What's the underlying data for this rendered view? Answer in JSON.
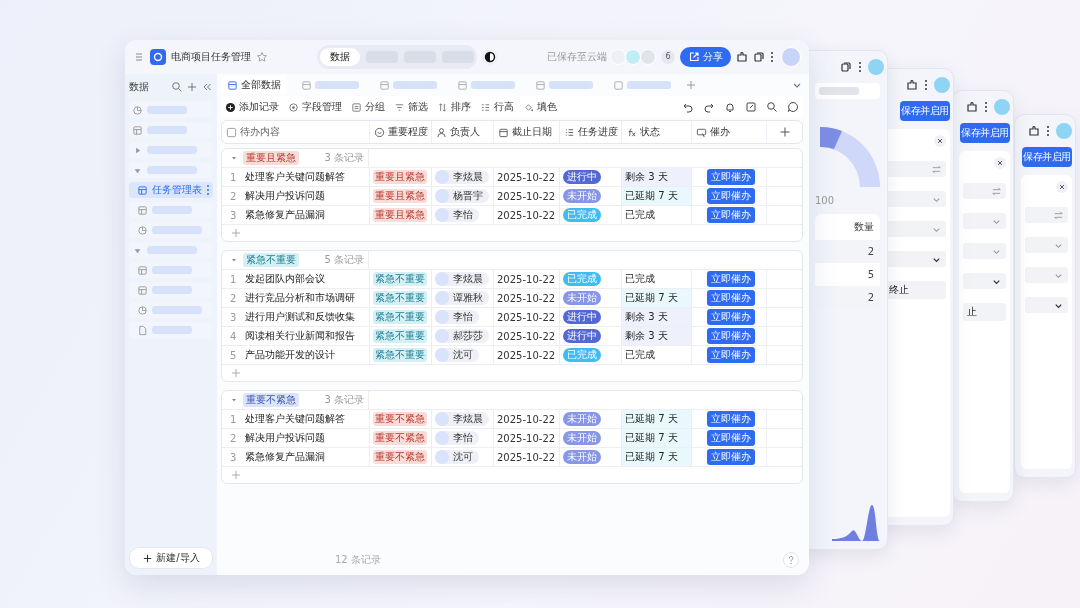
{
  "app": {
    "title": "电商项目任务管理",
    "mode_tabs": [
      {
        "label": "数据",
        "selected": true
      }
    ],
    "save_status": "已保存至云端",
    "collaborator_count": "6",
    "share_label": "分享"
  },
  "sidebar": {
    "heading": "数据",
    "items": [
      {
        "kind": "dashboard",
        "selected": false
      },
      {
        "kind": "table",
        "selected": false
      },
      {
        "kind": "folder",
        "expanded": false,
        "selected": false
      },
      {
        "kind": "folder",
        "expanded": true,
        "selected": false,
        "children": [
          {
            "kind": "table",
            "label": "任务管理表",
            "selected": true
          },
          {
            "kind": "table",
            "selected": false
          },
          {
            "kind": "dashboard",
            "selected": false
          }
        ]
      },
      {
        "kind": "folder",
        "expanded": true,
        "selected": false,
        "children": [
          {
            "kind": "table",
            "selected": false
          },
          {
            "kind": "table",
            "selected": false
          },
          {
            "kind": "dashboard",
            "selected": false
          },
          {
            "kind": "doc",
            "selected": false
          }
        ]
      }
    ],
    "new_button": "新建/导入"
  },
  "view_tabs": [
    {
      "label": "全部数据",
      "selected": true
    },
    {
      "kind": "gallery",
      "selected": false
    },
    {
      "kind": "table",
      "selected": false
    },
    {
      "kind": "form",
      "selected": false
    },
    {
      "kind": "gallery",
      "selected": false
    },
    {
      "kind": "doc",
      "selected": false
    }
  ],
  "toolbar": [
    {
      "kind": "add",
      "label": "添加记录"
    },
    {
      "kind": "fields",
      "label": "字段管理"
    },
    {
      "kind": "group",
      "label": "分组"
    },
    {
      "kind": "filter",
      "label": "筛选"
    },
    {
      "kind": "sort",
      "label": "排序"
    },
    {
      "kind": "height",
      "label": "行高"
    },
    {
      "kind": "fill",
      "label": "填色"
    }
  ],
  "columns": [
    {
      "kind": "text",
      "label": "待办内容"
    },
    {
      "kind": "select",
      "label": "重要程度"
    },
    {
      "kind": "person",
      "label": "负责人"
    },
    {
      "kind": "date",
      "label": "截止日期"
    },
    {
      "kind": "progress",
      "label": "任务进度"
    },
    {
      "kind": "formula",
      "label": "状态"
    },
    {
      "kind": "button",
      "label": "催办"
    }
  ],
  "groups": [
    {
      "tag": "重要且紧急",
      "color": "#f8dcd8",
      "count": "3 条记录",
      "rows": [
        {
          "no": "1",
          "task": "处理客户关键问题解答",
          "priority": {
            "label": "重要且紧急",
            "color": "#f8dcd8"
          },
          "owner": "李炫晨",
          "due": "2025-10-22",
          "progress": {
            "label": "进行中",
            "color": "#5468d4"
          },
          "status": {
            "label": "剩余 3 天",
            "kind": "remaining"
          },
          "action": "立即催办"
        },
        {
          "no": "2",
          "task": "解决用户投诉问题",
          "priority": {
            "label": "重要且紧急",
            "color": "#f8dcd8"
          },
          "owner": "杨晋宇",
          "due": "2025-10-22",
          "progress": {
            "label": "未开始",
            "color": "#8797e6"
          },
          "status": {
            "label": "已延期 7 天",
            "kind": "overdue"
          },
          "action": "立即催办"
        },
        {
          "no": "3",
          "task": "紧急修复产品漏洞",
          "priority": {
            "label": "重要且紧急",
            "color": "#f8dcd8"
          },
          "owner": "李怡",
          "due": "2025-10-22",
          "progress": {
            "label": "已完成",
            "color": "#3fbdf0"
          },
          "status": {
            "label": "已完成",
            "kind": "done"
          },
          "action": "立即催办"
        }
      ]
    },
    {
      "tag": "紧急不重要",
      "color": "#d5f0f4",
      "count": "5 条记录",
      "rows": [
        {
          "no": "1",
          "task": "发起团队内部会议",
          "priority": {
            "label": "紧急不重要",
            "color": "#d5f0f4"
          },
          "owner": "李炫晨",
          "due": "2025-10-22",
          "progress": {
            "label": "已完成",
            "color": "#3fbdf0"
          },
          "status": {
            "label": "已完成",
            "kind": "done"
          },
          "action": "立即催办"
        },
        {
          "no": "2",
          "task": "进行竞品分析和市场调研",
          "priority": {
            "label": "紧急不重要",
            "color": "#d5f0f4"
          },
          "owner": "谭雅秋",
          "due": "2025-10-22",
          "progress": {
            "label": "未开始",
            "color": "#8797e6"
          },
          "status": {
            "label": "已延期 7 天",
            "kind": "overdue"
          },
          "action": "立即催办"
        },
        {
          "no": "3",
          "task": "进行用户测试和反馈收集",
          "priority": {
            "label": "紧急不重要",
            "color": "#d5f0f4"
          },
          "owner": "李怡",
          "due": "2025-10-22",
          "progress": {
            "label": "进行中",
            "color": "#5468d4"
          },
          "status": {
            "label": "剩余 3 天",
            "kind": "remaining"
          },
          "action": "立即催办"
        },
        {
          "no": "4",
          "task": "阅读相关行业新闻和报告",
          "priority": {
            "label": "紧急不重要",
            "color": "#d5f0f4"
          },
          "owner": "郝莎莎",
          "due": "2025-10-22",
          "progress": {
            "label": "进行中",
            "color": "#5468d4"
          },
          "status": {
            "label": "剩余 3 天",
            "kind": "remaining"
          },
          "action": "立即催办"
        },
        {
          "no": "5",
          "task": "产品功能开发的设计",
          "priority": {
            "label": "紧急不重要",
            "color": "#d5f0f4"
          },
          "owner": "沈可",
          "due": "2025-10-22",
          "progress": {
            "label": "已完成",
            "color": "#3fbdf0"
          },
          "status": {
            "label": "已完成",
            "kind": "done"
          },
          "action": "立即催办"
        }
      ]
    },
    {
      "tag": "重要不紧急",
      "color": "#dce4fa",
      "count": "3 条记录",
      "rows": [
        {
          "no": "1",
          "task": "处理客户关键问题解答",
          "priority": {
            "label": "重要不紧急",
            "color": "#f8dcd8"
          },
          "owner": "李炫晨",
          "due": "2025-10-22",
          "progress": {
            "label": "未开始",
            "color": "#8797e6"
          },
          "status": {
            "label": "已延期 7 天",
            "kind": "overdue"
          },
          "action": "立即催办"
        },
        {
          "no": "2",
          "task": "解决用户投诉问题",
          "priority": {
            "label": "重要不紧急",
            "color": "#f8dcd8"
          },
          "owner": "李怡",
          "due": "2025-10-22",
          "progress": {
            "label": "未开始",
            "color": "#8797e6"
          },
          "status": {
            "label": "已延期 7 天",
            "kind": "overdue"
          },
          "action": "立即催办"
        },
        {
          "no": "3",
          "task": "紧急修复产品漏洞",
          "priority": {
            "label": "重要不紧急",
            "color": "#f8dcd8"
          },
          "owner": "沈可",
          "due": "2025-10-22",
          "progress": {
            "label": "未开始",
            "color": "#8797e6"
          },
          "status": {
            "label": "已延期 7 天",
            "kind": "overdue"
          },
          "action": "立即催办"
        }
      ]
    }
  ],
  "footer": {
    "record_count": "12 条记录"
  },
  "back_windows": [
    {
      "kind": "chart",
      "gauge_label": "100",
      "table_header": "数量",
      "table_values": [
        "2",
        "5",
        "2"
      ]
    },
    {
      "kind": "form",
      "button": "保存并启用",
      "field_value": "终止"
    },
    {
      "kind": "form",
      "button": "保存并启用",
      "field_value": "止"
    },
    {
      "kind": "form",
      "button": "保存并启用"
    }
  ]
}
